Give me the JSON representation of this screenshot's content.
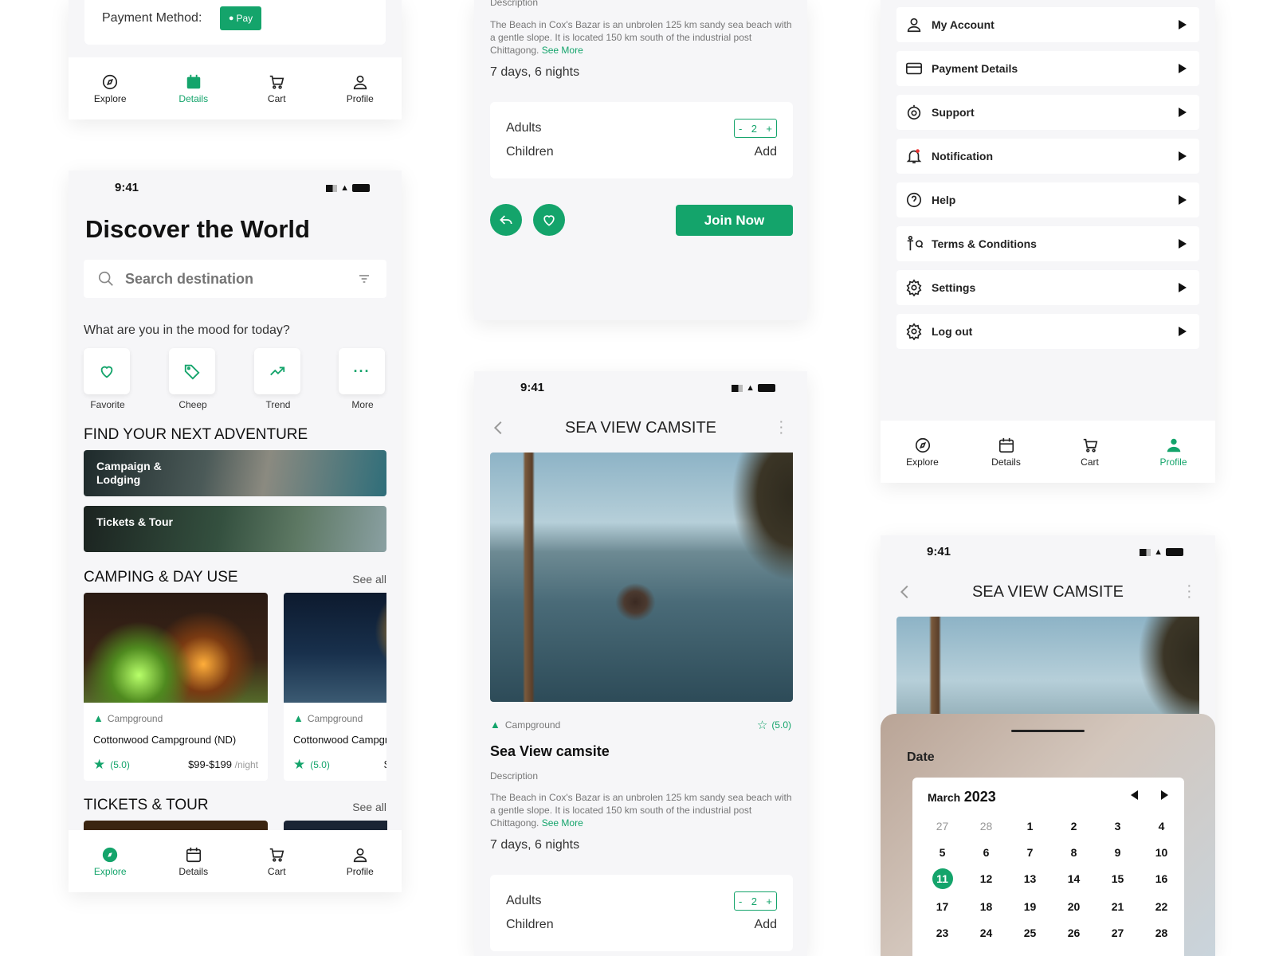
{
  "colors": {
    "accent": "#14a46b",
    "background": "#ffffff",
    "card": "#f6f6f8"
  },
  "common": {
    "time": "9:41",
    "tabs": {
      "explore": "Explore",
      "details": "Details",
      "cart": "Cart",
      "profile": "Profile"
    }
  },
  "screen1": {
    "payment_label": "Payment Method:",
    "pay_button": "Pay"
  },
  "screen2": {
    "title": "Discover the World",
    "search_placeholder": "Search destination",
    "mood_question": "What are you in the mood for today?",
    "moods": [
      "Favorite",
      "Cheep",
      "Trend",
      "More"
    ],
    "adventure_heading": "FIND YOUR NEXT ADVENTURE",
    "banners": [
      "Campaign & Lodging",
      "Tickets & Tour"
    ],
    "camping_heading": "CAMPING & DAY USE",
    "see_all": "See all",
    "places": [
      {
        "category": "Campground",
        "name": "Cottonwood Campground (ND)",
        "rating": "(5.0)",
        "price": "$99-$199",
        "unit": "/night"
      },
      {
        "category": "Campground",
        "name": "Cottonwood Campground",
        "rating": "(5.0)",
        "price": "$",
        "unit": ""
      }
    ],
    "tickets_heading": "TICKETS & TOUR"
  },
  "screen3": {
    "description_label": "Description",
    "description": "The Beach in Cox's Bazar is an unbrolen 125 km sandy sea beach with a gentle slope. It is located 150 km south of the industrial post Chittagong.",
    "see_more": "See More",
    "duration": "7 days, 6 nights",
    "adults_label": "Adults",
    "adults_value": "2",
    "children_label": "Children",
    "children_action": "Add",
    "join_button": "Join Now"
  },
  "screen4": {
    "title": "SEA VIEW CAMSITE",
    "category": "Campground",
    "rating": "(5.0)",
    "name": "Sea View camsite",
    "description_label": "Description",
    "description": "The Beach in Cox's Bazar is an unbrolen 125 km sandy sea beach with a gentle slope. It is located 150 km south of the industrial post Chittagong.",
    "see_more": "See More",
    "duration": "7 days, 6 nights",
    "adults_label": "Adults",
    "adults_value": "2",
    "children_label": "Children",
    "children_action": "Add"
  },
  "screen5": {
    "menu": [
      {
        "label": "My Account",
        "icon": "user-icon"
      },
      {
        "label": "Payment Details",
        "icon": "card-icon"
      },
      {
        "label": "Support",
        "icon": "support-icon"
      },
      {
        "label": "Notification",
        "icon": "bell-icon"
      },
      {
        "label": "Help",
        "icon": "help-icon"
      },
      {
        "label": "Terms & Conditions",
        "icon": "terms-icon"
      },
      {
        "label": "Settings",
        "icon": "gear-icon"
      },
      {
        "label": "Log out",
        "icon": "gear-icon"
      }
    ]
  },
  "screen6": {
    "title": "SEA VIEW CAMSITE",
    "date_label": "Date",
    "month": "March",
    "year": "2023",
    "days": [
      [
        "27",
        "28",
        "1",
        "2",
        "3",
        "4"
      ],
      [
        "5",
        "6",
        "7",
        "8",
        "9",
        "10"
      ],
      [
        "11",
        "12",
        "13",
        "14",
        "15",
        "16"
      ],
      [
        "17",
        "18",
        "19",
        "20",
        "21",
        "22"
      ],
      [
        "23",
        "24",
        "25",
        "26",
        "27",
        "28"
      ]
    ],
    "selected_day": "11"
  }
}
